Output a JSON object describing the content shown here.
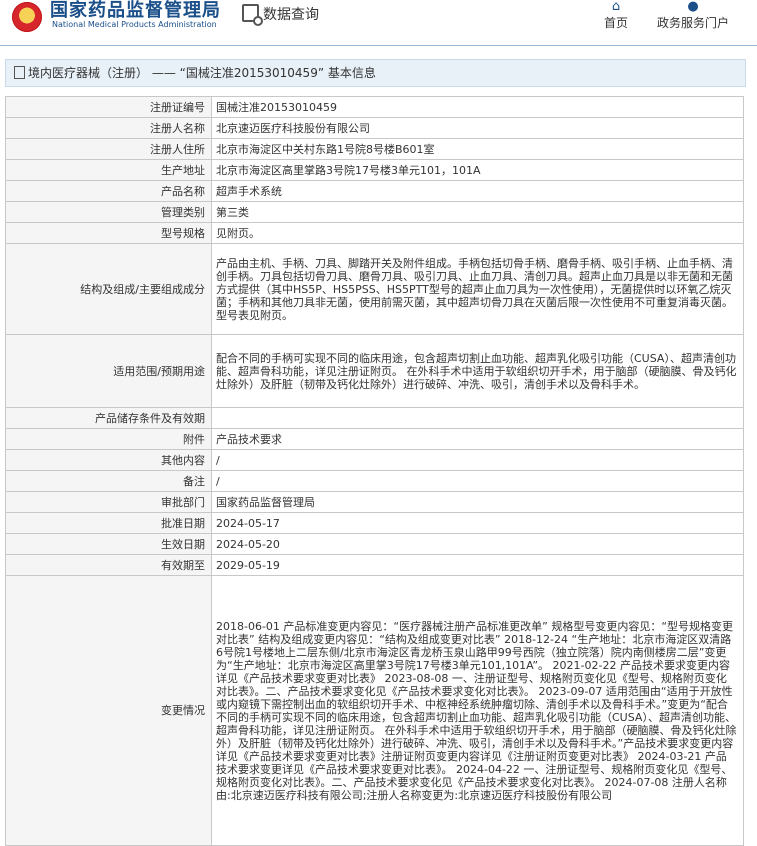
{
  "header": {
    "title": "国家药品监督管理局",
    "subtitle": "National Medical Products Administration",
    "query_label": "数据查询",
    "nav": [
      {
        "label": "首页",
        "icon": "home-icon"
      },
      {
        "label": "政务服务门户",
        "icon": "user-icon"
      }
    ]
  },
  "breadcrumb": "境内医疗器械（注册） —— “国械注准20153010459” 基本信息",
  "rows": [
    {
      "k": "注册证编号",
      "v": "国械注准20153010459"
    },
    {
      "k": "注册人名称",
      "v": "北京速迈医疗科技股份有限公司"
    },
    {
      "k": "注册人住所",
      "v": "北京市海淀区中关村东路1号院8号楼B601室"
    },
    {
      "k": "生产地址",
      "v": "北京市海淀区高里掌路3号院17号楼3单元101，101A"
    },
    {
      "k": "产品名称",
      "v": "超声手术系统"
    },
    {
      "k": "管理类别",
      "v": "第三类"
    },
    {
      "k": "型号规格",
      "v": "见附页。"
    },
    {
      "k": "结构及组成/主要组成成分",
      "v": "产品由主机、手柄、刀具、脚踏开关及附件组成。手柄包括切骨手柄、磨骨手柄、吸引手柄、止血手柄、清创手柄。刀具包括切骨刀具、磨骨刀具、吸引刀具、止血刀具、清创刀具。超声止血刀具是以非无菌和无菌方式提供（其中HS5P、HS5PSS、HS5PTT型号的超声止血刀具为一次性使用），无菌提供时以环氧乙烷灭菌；手柄和其他刀具非无菌，使用前需灭菌，其中超声切骨刀具在灭菌后限一次性使用不可重复消毒灭菌。型号表见附页。"
    },
    {
      "k": "适用范围/预期用途",
      "v": "配合不同的手柄可实现不同的临床用途，包含超声切割止血功能、超声乳化吸引功能（CUSA）、超声清创功能、超声骨科功能，详见注册证附页。 在外科手术中适用于软组织切开手术，用于脑部（硬脑膜、骨及钙化灶除外）及肝脏（韧带及钙化灶除外）进行破碎、冲洗、吸引，清创手术以及骨科手术。"
    },
    {
      "k": "产品储存条件及有效期",
      "v": ""
    },
    {
      "k": "附件",
      "v": "产品技术要求"
    },
    {
      "k": "其他内容",
      "v": "/"
    },
    {
      "k": "备注",
      "v": "/"
    },
    {
      "k": "审批部门",
      "v": "国家药品监督管理局"
    },
    {
      "k": "批准日期",
      "v": "2024-05-17"
    },
    {
      "k": "生效日期",
      "v": "2024-05-20"
    },
    {
      "k": "有效期至",
      "v": "2029-05-19"
    },
    {
      "k": "变更情况",
      "v": "2018-06-01 产品标准变更内容见：“医疗器械注册产品标准更改单” 规格型号变更内容见：“型号规格变更对比表” 结构及组成变更内容见：“结构及组成变更对比表” 2018-12-24 “生产地址：北京市海淀区双清路6号院1号楼地上二层东侧/北京市海淀区青龙桥玉泉山路甲99号西院（独立院落）院内南侧楼房二层”变更为“生产地址：北京市海淀区高里掌3号院17号楼3单元101,101A”。 2021-02-22 产品技术要求变更内容详见《产品技术要求变更对比表》 2023-08-08 一、注册证型号、规格附页变化见《型号、规格附页变化对比表》。二、产品技术要求变化见《产品技术要求变化对比表》。 2023-09-07 适用范围由“适用于开放性或内窥镜下需控制出血的软组织切开手术、中枢神经系统肿瘤切除、清创手术以及骨科手术。”变更为“配合不同的手柄可实现不同的临床用途，包含超声切割止血功能、超声乳化吸引功能（CUSA）、超声清创功能、超声骨科功能，详见注册证附页。 在外科手术中适用于软组织切开手术，用于脑部（硬脑膜、骨及钙化灶除外）及肝脏（韧带及钙化灶除外）进行破碎、冲洗、吸引，清创手术以及骨科手术。”产品技术要求变更内容详见《产品技术要求变更对比表》注册证附页变更内容详见《注册证附页变更对比表》 2024-03-21 产品技术要求变更详见《产品技术要求变更对比表》。 2024-04-22 一、注册证型号、规格附页变化见《型号、规格附页变化对比表》。二、产品技术要求变化见《产品技术要求变化对比表》。 2024-07-08 注册人名称由:北京速迈医疗科技有限公司;注册人名称变更为:北京速迈医疗科技股份有限公司"
    }
  ]
}
